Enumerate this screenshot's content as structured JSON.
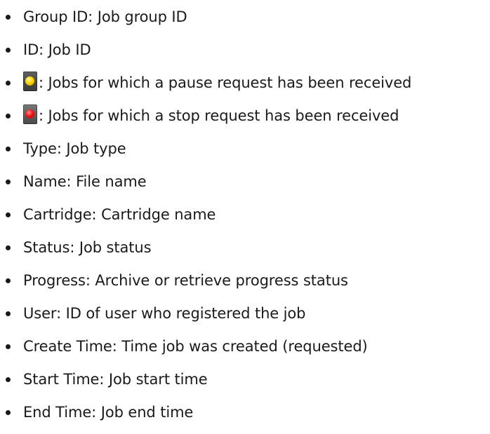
{
  "items": [
    {
      "text": "Group ID: Job group ID"
    },
    {
      "text": "ID: Job ID"
    },
    {
      "icon": "yellow-status-icon",
      "icon_color": "#ffd400",
      "text": ": Jobs for which a pause request has been received"
    },
    {
      "icon": "red-status-icon",
      "icon_color": "#f01818",
      "text": ": Jobs for which a stop request has been received"
    },
    {
      "text": "Type: Job type"
    },
    {
      "text": "Name: File name"
    },
    {
      "text": "Cartridge: Cartridge name"
    },
    {
      "text": "Status: Job status"
    },
    {
      "text": "Progress: Archive or retrieve progress status"
    },
    {
      "text": "User: ID of user who registered the job"
    },
    {
      "text": "Create Time: Time job was created (requested)"
    },
    {
      "text": "Start Time: Job start time"
    },
    {
      "text": "End Time: Job end time"
    }
  ]
}
